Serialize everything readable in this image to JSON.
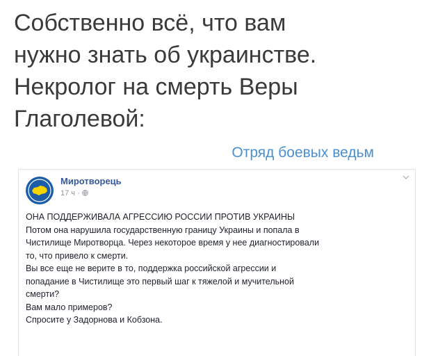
{
  "headline": {
    "lines": [
      "Собственно всё, что вам",
      "нужно знать об украинстве.",
      "Некролог на смерть Веры",
      "Глаголевой:"
    ]
  },
  "source_tag": "Отряд боевых ведьм",
  "post": {
    "author": "Миротворець",
    "time": "17 ч",
    "audience_icon": "globe-icon",
    "menu_icon": "chevron-down-icon",
    "lines": [
      "ОНА ПОДДЕРЖИВАЛА АГРЕССИЮ РОССИИ ПРОТИВ УКРАИНЫ",
      "Потом она нарушила государственную границу Украины и попала в",
      "Чистилище Миротворца. Через некоторое время у нее диагностировали",
      "то, что привело к смерти.",
      "Вы все еще не верите в то, поддержка российской агрессии и",
      "попадание в Чистилище это первый шаг к тяжелой и мучительной",
      "смерти?",
      "Вам мало примеров?",
      "Спросите у Задорнова и Кобзона."
    ]
  },
  "colors": {
    "headline": "#3a3a3a",
    "source_tag": "#4a8fd0",
    "author": "#365899",
    "avatar": "#1b5da8",
    "map": "#f5d400"
  }
}
